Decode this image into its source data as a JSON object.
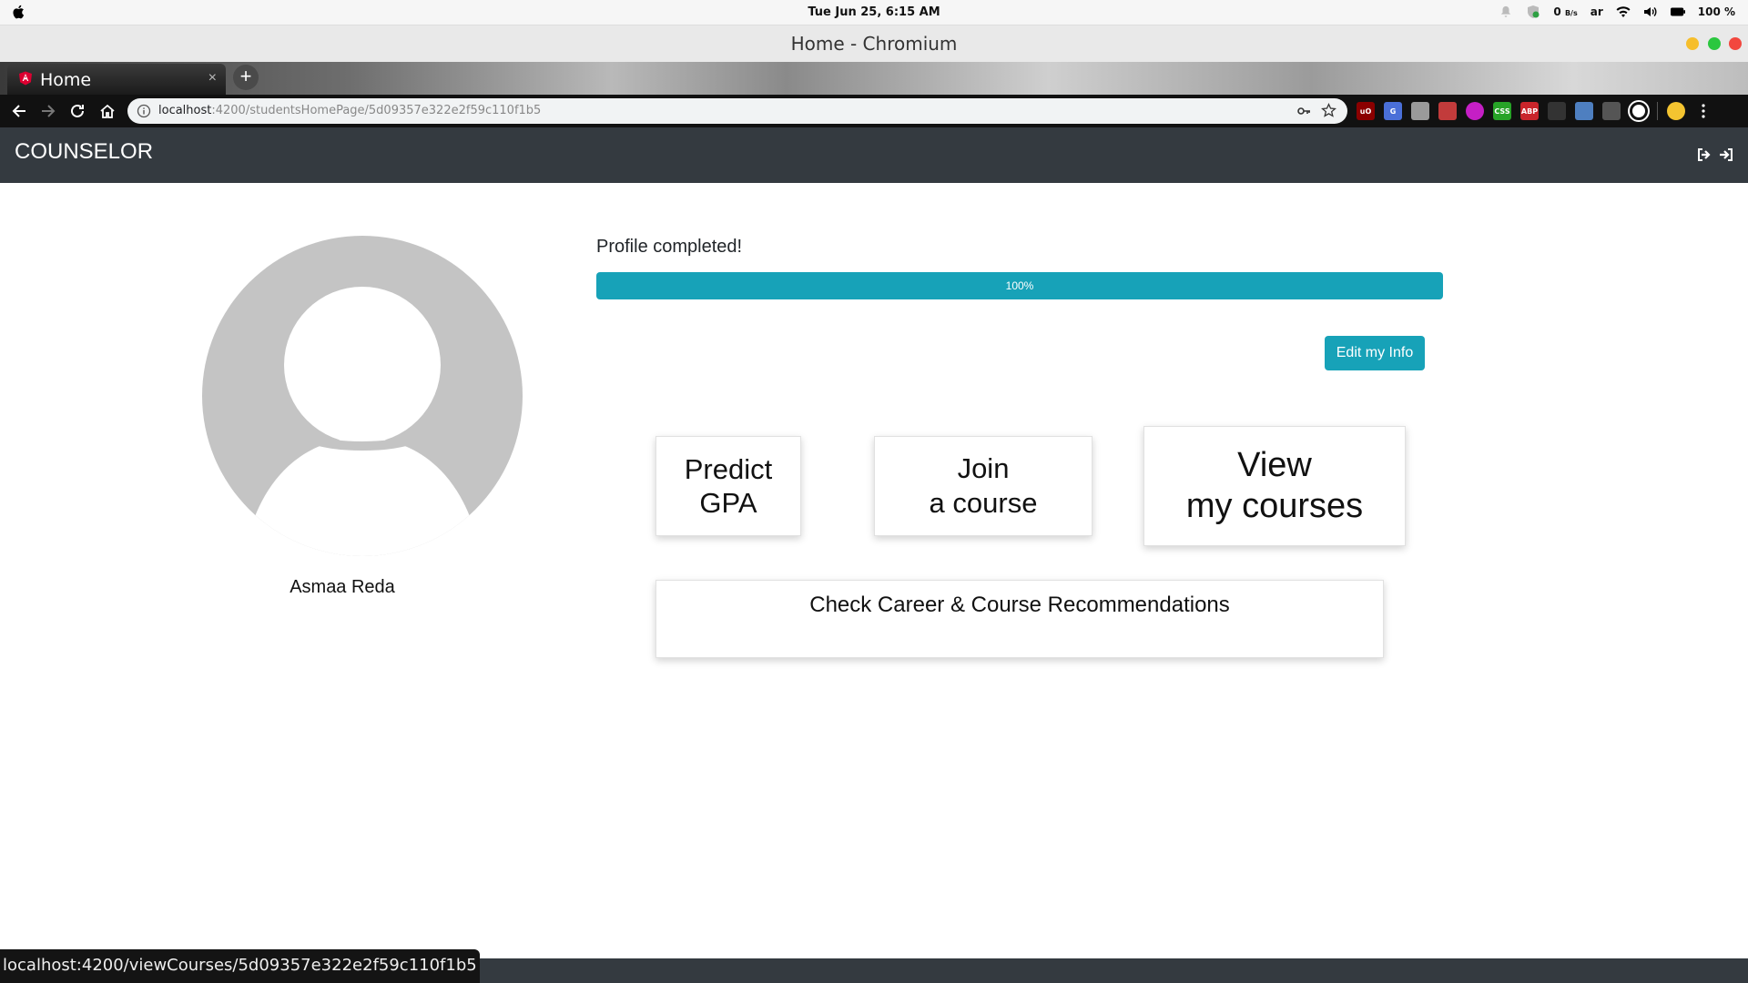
{
  "os": {
    "clock": "Tue Jun 25,  6:15 AM",
    "net_speed": "0",
    "net_unit": "B/s",
    "keyboard_layout": "ar",
    "battery": "100 %"
  },
  "window": {
    "title": "Home - Chromium"
  },
  "browser": {
    "tab_title": "Home",
    "tab_close": "×",
    "new_tab": "+",
    "url_host": "localhost",
    "url_path": ":4200/studentsHomePage/5d09357e322e2f59c110f1b5",
    "extensions": [
      {
        "name": "ublock-extension-icon",
        "text": "uO",
        "color": "#8b0000"
      },
      {
        "name": "translate-extension-icon",
        "text": "G",
        "color": "#4a6fd8"
      },
      {
        "name": "page-extension-icon",
        "text": "",
        "color": "#9a9a9a"
      },
      {
        "name": "pen-extension-icon",
        "text": "",
        "color": "#c23b3b"
      },
      {
        "name": "colorpick-extension-icon",
        "text": "",
        "color": "#c51fc5"
      },
      {
        "name": "css-extension-icon",
        "text": "CSS",
        "color": "#27a327"
      },
      {
        "name": "abp-extension-icon",
        "text": "ABP",
        "color": "#c9252b"
      },
      {
        "name": "arrow-extension-icon",
        "text": "",
        "color": "#333333"
      },
      {
        "name": "bookmark-extension-icon",
        "text": "",
        "color": "#4e7fc0"
      },
      {
        "name": "download-extension-icon",
        "text": "",
        "color": "#555555"
      }
    ]
  },
  "app": {
    "brand": "COUNSELOR",
    "student_name": "Asmaa Reda",
    "profile": {
      "label": "Profile completed!",
      "progress": 1.0,
      "progress_text": "100%"
    },
    "edit_button": "Edit my Info",
    "cards": {
      "predict_line1": "Predict",
      "predict_line2": "GPA",
      "join_line1": "Join",
      "join_line2": "a course",
      "view_line1": "View",
      "view_line2": "my courses",
      "career": "Check Career & Course Recommendations"
    }
  },
  "status_bar": {
    "url": "localhost:4200/viewCourses/5d09357e322e2f59c110f1b5"
  },
  "colors": {
    "navbar": "#343a40",
    "accent": "#17a2b8",
    "avatar": "#c4c4c4"
  }
}
